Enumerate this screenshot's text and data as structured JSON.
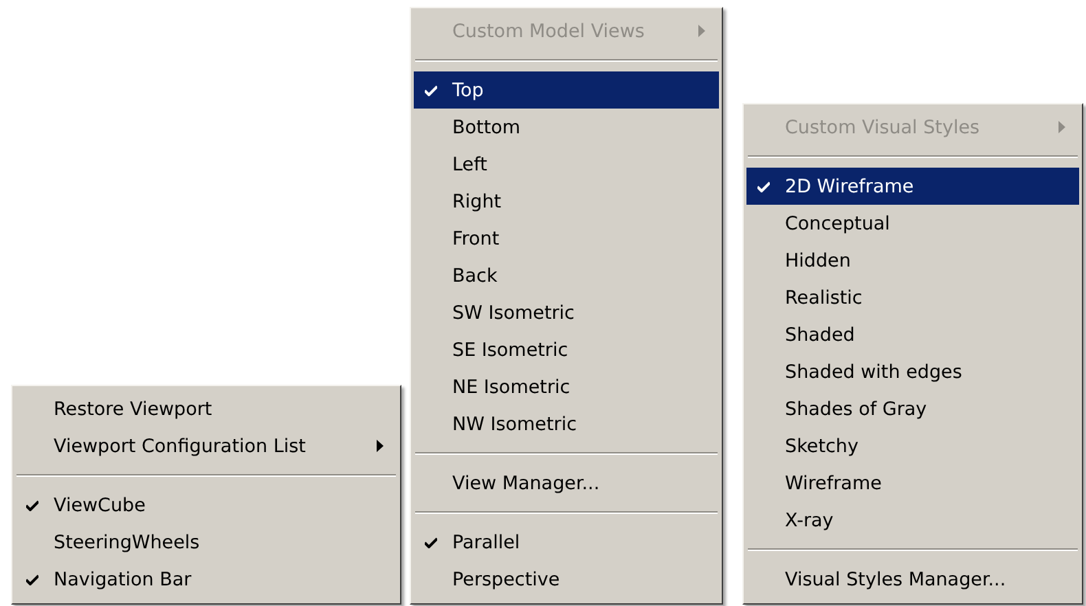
{
  "menus": [
    {
      "items": [
        {
          "kind": "item",
          "label": "Restore Viewport",
          "checked": false,
          "selected": false,
          "disabled": false,
          "submenu": false
        },
        {
          "kind": "item",
          "label": "Viewport Configuration List",
          "checked": false,
          "selected": false,
          "disabled": false,
          "submenu": true
        },
        {
          "kind": "separator"
        },
        {
          "kind": "item",
          "label": "ViewCube",
          "checked": true,
          "selected": false,
          "disabled": false,
          "submenu": false
        },
        {
          "kind": "item",
          "label": "SteeringWheels",
          "checked": false,
          "selected": false,
          "disabled": false,
          "submenu": false
        },
        {
          "kind": "item",
          "label": "Navigation Bar",
          "checked": true,
          "selected": false,
          "disabled": false,
          "submenu": false
        }
      ]
    },
    {
      "items": [
        {
          "kind": "item",
          "label": "Custom Model Views",
          "checked": false,
          "selected": false,
          "disabled": true,
          "submenu": true
        },
        {
          "kind": "separator"
        },
        {
          "kind": "item",
          "label": "Top",
          "checked": true,
          "selected": true,
          "disabled": false,
          "submenu": false
        },
        {
          "kind": "item",
          "label": "Bottom",
          "checked": false,
          "selected": false,
          "disabled": false,
          "submenu": false
        },
        {
          "kind": "item",
          "label": "Left",
          "checked": false,
          "selected": false,
          "disabled": false,
          "submenu": false
        },
        {
          "kind": "item",
          "label": "Right",
          "checked": false,
          "selected": false,
          "disabled": false,
          "submenu": false
        },
        {
          "kind": "item",
          "label": "Front",
          "checked": false,
          "selected": false,
          "disabled": false,
          "submenu": false
        },
        {
          "kind": "item",
          "label": "Back",
          "checked": false,
          "selected": false,
          "disabled": false,
          "submenu": false
        },
        {
          "kind": "item",
          "label": "SW Isometric",
          "checked": false,
          "selected": false,
          "disabled": false,
          "submenu": false
        },
        {
          "kind": "item",
          "label": "SE Isometric",
          "checked": false,
          "selected": false,
          "disabled": false,
          "submenu": false
        },
        {
          "kind": "item",
          "label": "NE Isometric",
          "checked": false,
          "selected": false,
          "disabled": false,
          "submenu": false
        },
        {
          "kind": "item",
          "label": "NW Isometric",
          "checked": false,
          "selected": false,
          "disabled": false,
          "submenu": false
        },
        {
          "kind": "separator"
        },
        {
          "kind": "item",
          "label": "View Manager...",
          "checked": false,
          "selected": false,
          "disabled": false,
          "submenu": false
        },
        {
          "kind": "separator"
        },
        {
          "kind": "item",
          "label": "Parallel",
          "checked": true,
          "selected": false,
          "disabled": false,
          "submenu": false
        },
        {
          "kind": "item",
          "label": "Perspective",
          "checked": false,
          "selected": false,
          "disabled": false,
          "submenu": false
        }
      ]
    },
    {
      "items": [
        {
          "kind": "item",
          "label": "Custom Visual Styles",
          "checked": false,
          "selected": false,
          "disabled": true,
          "submenu": true
        },
        {
          "kind": "separator"
        },
        {
          "kind": "item",
          "label": "2D Wireframe",
          "checked": true,
          "selected": true,
          "disabled": false,
          "submenu": false
        },
        {
          "kind": "item",
          "label": "Conceptual",
          "checked": false,
          "selected": false,
          "disabled": false,
          "submenu": false
        },
        {
          "kind": "item",
          "label": "Hidden",
          "checked": false,
          "selected": false,
          "disabled": false,
          "submenu": false
        },
        {
          "kind": "item",
          "label": "Realistic",
          "checked": false,
          "selected": false,
          "disabled": false,
          "submenu": false
        },
        {
          "kind": "item",
          "label": "Shaded",
          "checked": false,
          "selected": false,
          "disabled": false,
          "submenu": false
        },
        {
          "kind": "item",
          "label": "Shaded with edges",
          "checked": false,
          "selected": false,
          "disabled": false,
          "submenu": false
        },
        {
          "kind": "item",
          "label": "Shades of Gray",
          "checked": false,
          "selected": false,
          "disabled": false,
          "submenu": false
        },
        {
          "kind": "item",
          "label": "Sketchy",
          "checked": false,
          "selected": false,
          "disabled": false,
          "submenu": false
        },
        {
          "kind": "item",
          "label": "Wireframe",
          "checked": false,
          "selected": false,
          "disabled": false,
          "submenu": false
        },
        {
          "kind": "item",
          "label": "X-ray",
          "checked": false,
          "selected": false,
          "disabled": false,
          "submenu": false
        },
        {
          "kind": "separator"
        },
        {
          "kind": "item",
          "label": "Visual Styles Manager...",
          "checked": false,
          "selected": false,
          "disabled": false,
          "submenu": false
        }
      ]
    }
  ]
}
